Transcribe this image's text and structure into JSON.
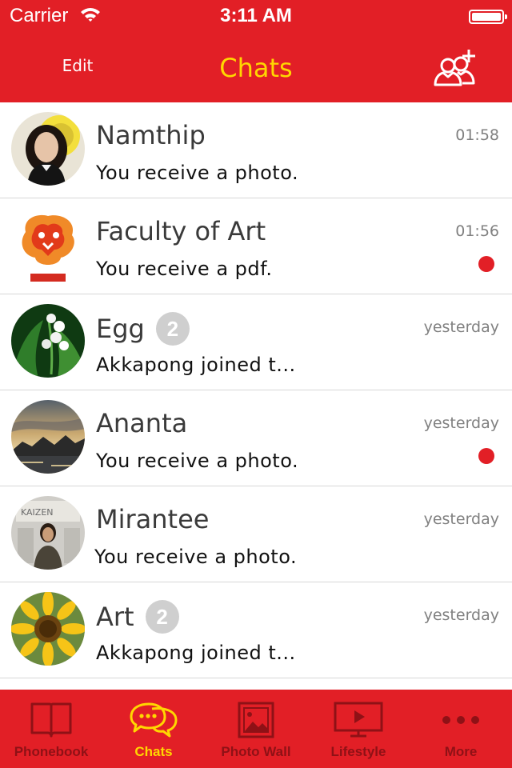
{
  "status": {
    "carrier": "Carrier",
    "time": "3:11 AM"
  },
  "header": {
    "edit_label": "Edit",
    "title": "Chats",
    "add_icon": "add-contact-icon"
  },
  "colors": {
    "brand_red": "#e21f26",
    "accent_yellow": "#ffd700",
    "unread_dot": "#e21f26"
  },
  "chats": [
    {
      "name": "Namthip",
      "message": "You receive a photo.",
      "time": "01:58",
      "badge": "",
      "unread": false
    },
    {
      "name": "Faculty of Art",
      "message": "You receive a pdf.",
      "time": "01:56",
      "badge": "",
      "unread": true
    },
    {
      "name": "Egg",
      "message": "Akkapong joined t...",
      "time": "yesterday",
      "badge": "2",
      "unread": false
    },
    {
      "name": "Ananta",
      "message": "You receive a photo.",
      "time": "yesterday",
      "badge": "",
      "unread": true
    },
    {
      "name": "Mirantee",
      "message": "You receive a photo.",
      "time": "yesterday",
      "badge": "",
      "unread": false
    },
    {
      "name": "Art",
      "message": "Akkapong joined t...",
      "time": "yesterday",
      "badge": "2",
      "unread": false
    }
  ],
  "tabs": [
    {
      "label": "Phonebook",
      "icon": "book-icon",
      "active": false
    },
    {
      "label": "Chats",
      "icon": "chat-bubbles-icon",
      "active": true
    },
    {
      "label": "Photo  Wall",
      "icon": "photo-icon",
      "active": false
    },
    {
      "label": "Lifestyle",
      "icon": "tv-play-icon",
      "active": false
    },
    {
      "label": "More",
      "icon": "more-dots-icon",
      "active": false
    }
  ]
}
